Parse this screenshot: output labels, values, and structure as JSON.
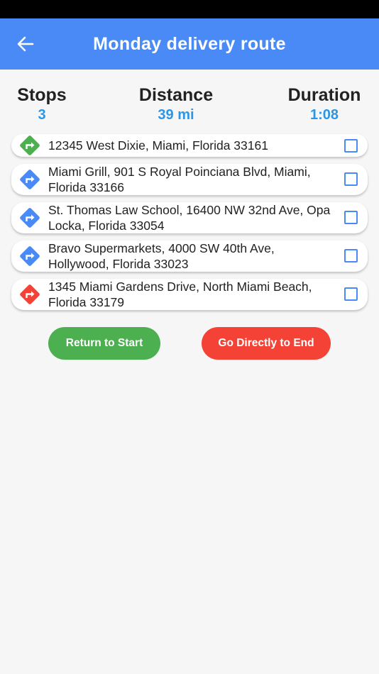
{
  "app_bar": {
    "title": "Monday delivery route",
    "back_icon": "arrow-left-icon"
  },
  "summary": {
    "stops_label": "Stops",
    "stops_value": "3",
    "distance_label": "Distance",
    "distance_value": "39 mi",
    "duration_label": "Duration",
    "duration_value": "1:08"
  },
  "stops": [
    {
      "address": "12345 West Dixie, Miami, Florida 33161",
      "icon": "turn-right-green-icon",
      "color": "#4caf50",
      "checked": false
    },
    {
      "address": "Miami Grill, 901 S Royal Poinciana Blvd, Miami, Florida 33166",
      "icon": "turn-right-blue-icon",
      "color": "#4a8af6",
      "checked": false
    },
    {
      "address": "St. Thomas Law School, 16400 NW 32nd Ave, Opa Locka, Florida 33054",
      "icon": "turn-right-blue-icon",
      "color": "#4a8af6",
      "checked": false
    },
    {
      "address": "Bravo Supermarkets, 4000 SW 40th Ave, Hollywood, Florida 33023",
      "icon": "turn-right-blue-icon",
      "color": "#4a8af6",
      "checked": false
    },
    {
      "address": "1345 Miami Gardens Drive, North Miami Beach, Florida 33179",
      "icon": "turn-right-red-icon",
      "color": "#f44336",
      "checked": false
    }
  ],
  "actions": {
    "return_label": "Return to Start",
    "end_label": "Go Directly to End"
  },
  "colors": {
    "app_bar": "#4a8af6",
    "accent_value": "#2a96e6",
    "start": "#4caf50",
    "end": "#f44336"
  }
}
